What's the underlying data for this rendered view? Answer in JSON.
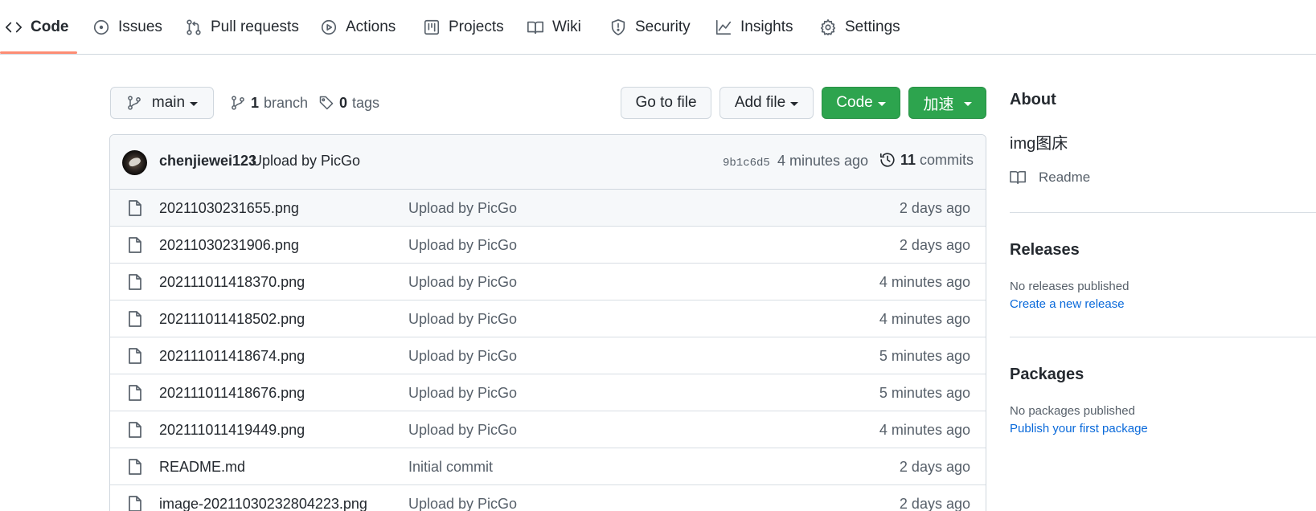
{
  "nav": {
    "tabs": [
      {
        "label": "Code",
        "icon": "code-icon",
        "active": true
      },
      {
        "label": "Issues",
        "icon": "issue-opened-icon"
      },
      {
        "label": "Pull requests",
        "icon": "git-pull-request-icon"
      },
      {
        "label": "Actions",
        "icon": "play-icon"
      },
      {
        "label": "Projects",
        "icon": "project-icon"
      },
      {
        "label": "Wiki",
        "icon": "book-icon"
      },
      {
        "label": "Security",
        "icon": "shield-icon"
      },
      {
        "label": "Insights",
        "icon": "graph-icon"
      },
      {
        "label": "Settings",
        "icon": "gear-icon"
      }
    ]
  },
  "repo_toolbar": {
    "branch_selector": "main",
    "branch_count": "1",
    "branch_label": "branch",
    "tag_count": "0",
    "tag_label": "tags",
    "go_to_file": "Go to file",
    "add_file": "Add file",
    "code_button": "Code",
    "accelerate_button": "加速"
  },
  "latest_commit": {
    "author": "chenjiewei123",
    "message": "Upload by PicGo",
    "sha": "9b1c6d5",
    "time": "4 minutes ago",
    "commit_count": "11",
    "commit_label": "commits"
  },
  "files": [
    {
      "name": "20211030231655.png",
      "message": "Upload by PicGo",
      "time": "2 days ago"
    },
    {
      "name": "20211030231906.png",
      "message": "Upload by PicGo",
      "time": "2 days ago"
    },
    {
      "name": "202111011418370.png",
      "message": "Upload by PicGo",
      "time": "4 minutes ago"
    },
    {
      "name": "202111011418502.png",
      "message": "Upload by PicGo",
      "time": "4 minutes ago"
    },
    {
      "name": "202111011418674.png",
      "message": "Upload by PicGo",
      "time": "5 minutes ago"
    },
    {
      "name": "202111011418676.png",
      "message": "Upload by PicGo",
      "time": "5 minutes ago"
    },
    {
      "name": "202111011419449.png",
      "message": "Upload by PicGo",
      "time": "4 minutes ago"
    },
    {
      "name": "README.md",
      "message": "Initial commit",
      "time": "2 days ago"
    },
    {
      "name": "image-20211030232804223.png",
      "message": "Upload by PicGo",
      "time": "2 days ago"
    }
  ],
  "sidebar": {
    "about_heading": "About",
    "description": "img图床",
    "readme_link": "Readme",
    "releases_heading": "Releases",
    "releases_empty": "No releases published",
    "create_release": "Create a new release",
    "packages_heading": "Packages",
    "packages_empty": "No packages published",
    "publish_package": "Publish your first package"
  },
  "colors": {
    "primary_button": "#2da44e",
    "active_tab_underline": "#fd8c73",
    "link": "#0969da",
    "border": "#d0d7de"
  }
}
